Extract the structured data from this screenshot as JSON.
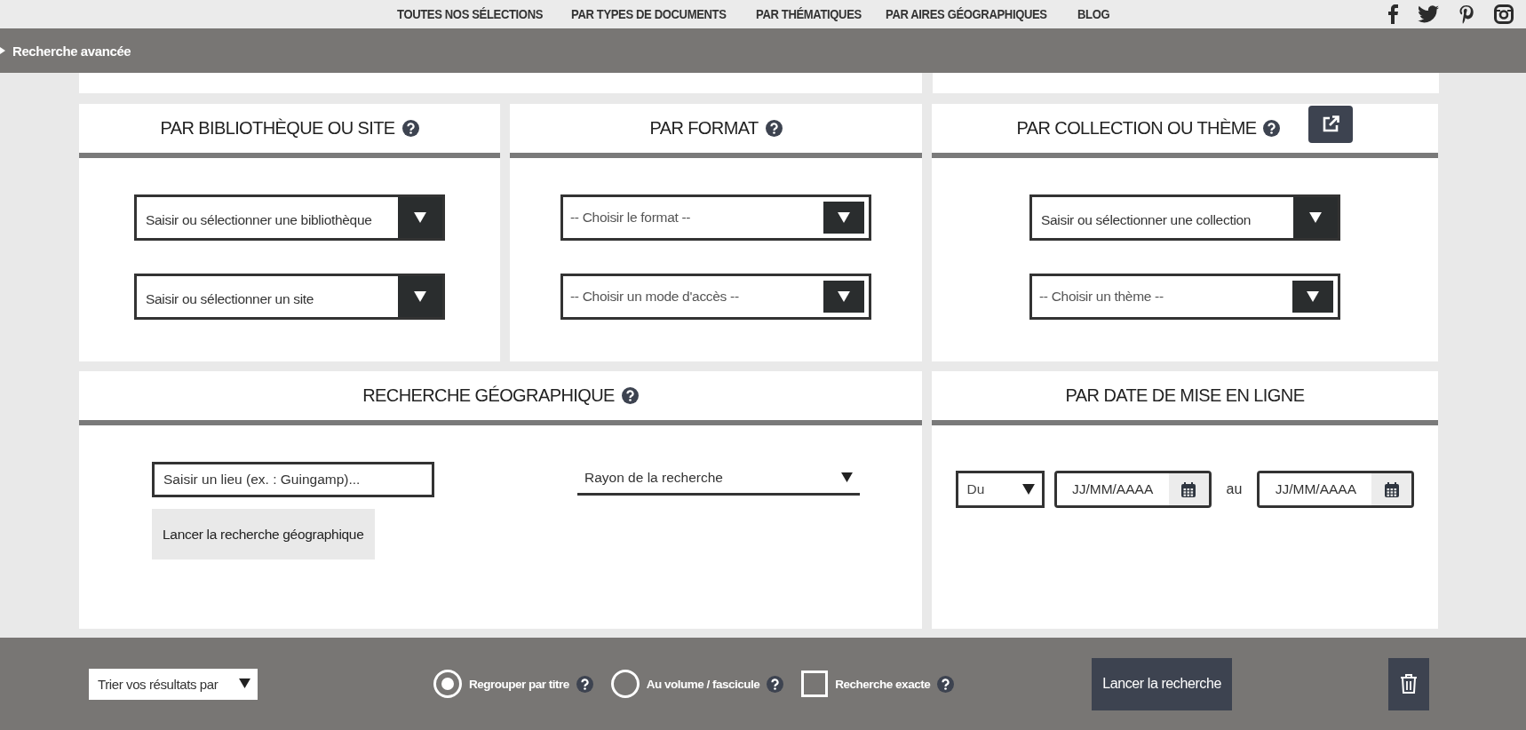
{
  "nav_links": [
    {
      "label": "TOUTES NOS SÉLECTIONS"
    },
    {
      "label": "PAR TYPES DE DOCUMENTS"
    },
    {
      "label": "PAR THÉMATIQUES"
    },
    {
      "label": "PAR AIRES GÉOGRAPHIQUES"
    },
    {
      "label": "BLOG"
    }
  ],
  "advanced_search": {
    "title": "Recherche avancée"
  },
  "sections": [
    {
      "title": "PAR BIBLIOTHÈQUE OU SITE",
      "help": true,
      "external_link": false,
      "fields": [
        {
          "kind": "combo",
          "placeholder": "Saisir ou sélectionner une bibliothèque"
        },
        {
          "kind": "combo",
          "placeholder": "Saisir ou sélectionner un site"
        }
      ]
    },
    {
      "title": "PAR FORMAT",
      "help": true,
      "external_link": false,
      "fields": [
        {
          "kind": "select",
          "value": "-- Choisir le format --"
        },
        {
          "kind": "select",
          "value": "-- Choisir un mode d'accès --"
        }
      ]
    },
    {
      "title": "PAR COLLECTION OU THÈME",
      "help": true,
      "external_link": true,
      "fields": [
        {
          "kind": "combo",
          "placeholder": "Saisir ou sélectionner une collection"
        },
        {
          "kind": "select",
          "value": "-- Choisir un thème --"
        }
      ]
    }
  ],
  "geo": {
    "title": "RECHERCHE GÉOGRAPHIQUE",
    "help": true,
    "place_field": {
      "placeholder": "Saisir un lieu (ex. : Guingamp)..."
    },
    "button": "Lancer la recherche géographique",
    "radius": {
      "value": "Rayon de la recherche"
    }
  },
  "date": {
    "title": "PAR DATE DE MISE EN LIGNE",
    "help": false,
    "mode": {
      "value": "Du"
    },
    "from": {
      "placeholder": "JJ/MM/AAAA"
    },
    "separator": "au",
    "to": {
      "placeholder": "JJ/MM/AAAA"
    }
  },
  "footer": {
    "sort": {
      "value": "Trier vos résultats par"
    },
    "options": [
      {
        "kind": "radio",
        "label": "Regrouper par titre",
        "selected": true,
        "help": true
      },
      {
        "kind": "radio",
        "label": "Au volume / fascicule",
        "selected": false,
        "help": true
      },
      {
        "kind": "checkbox",
        "label": "Recherche exacte",
        "checked": false,
        "help": true
      }
    ],
    "search_button": "Lancer la recherche"
  }
}
